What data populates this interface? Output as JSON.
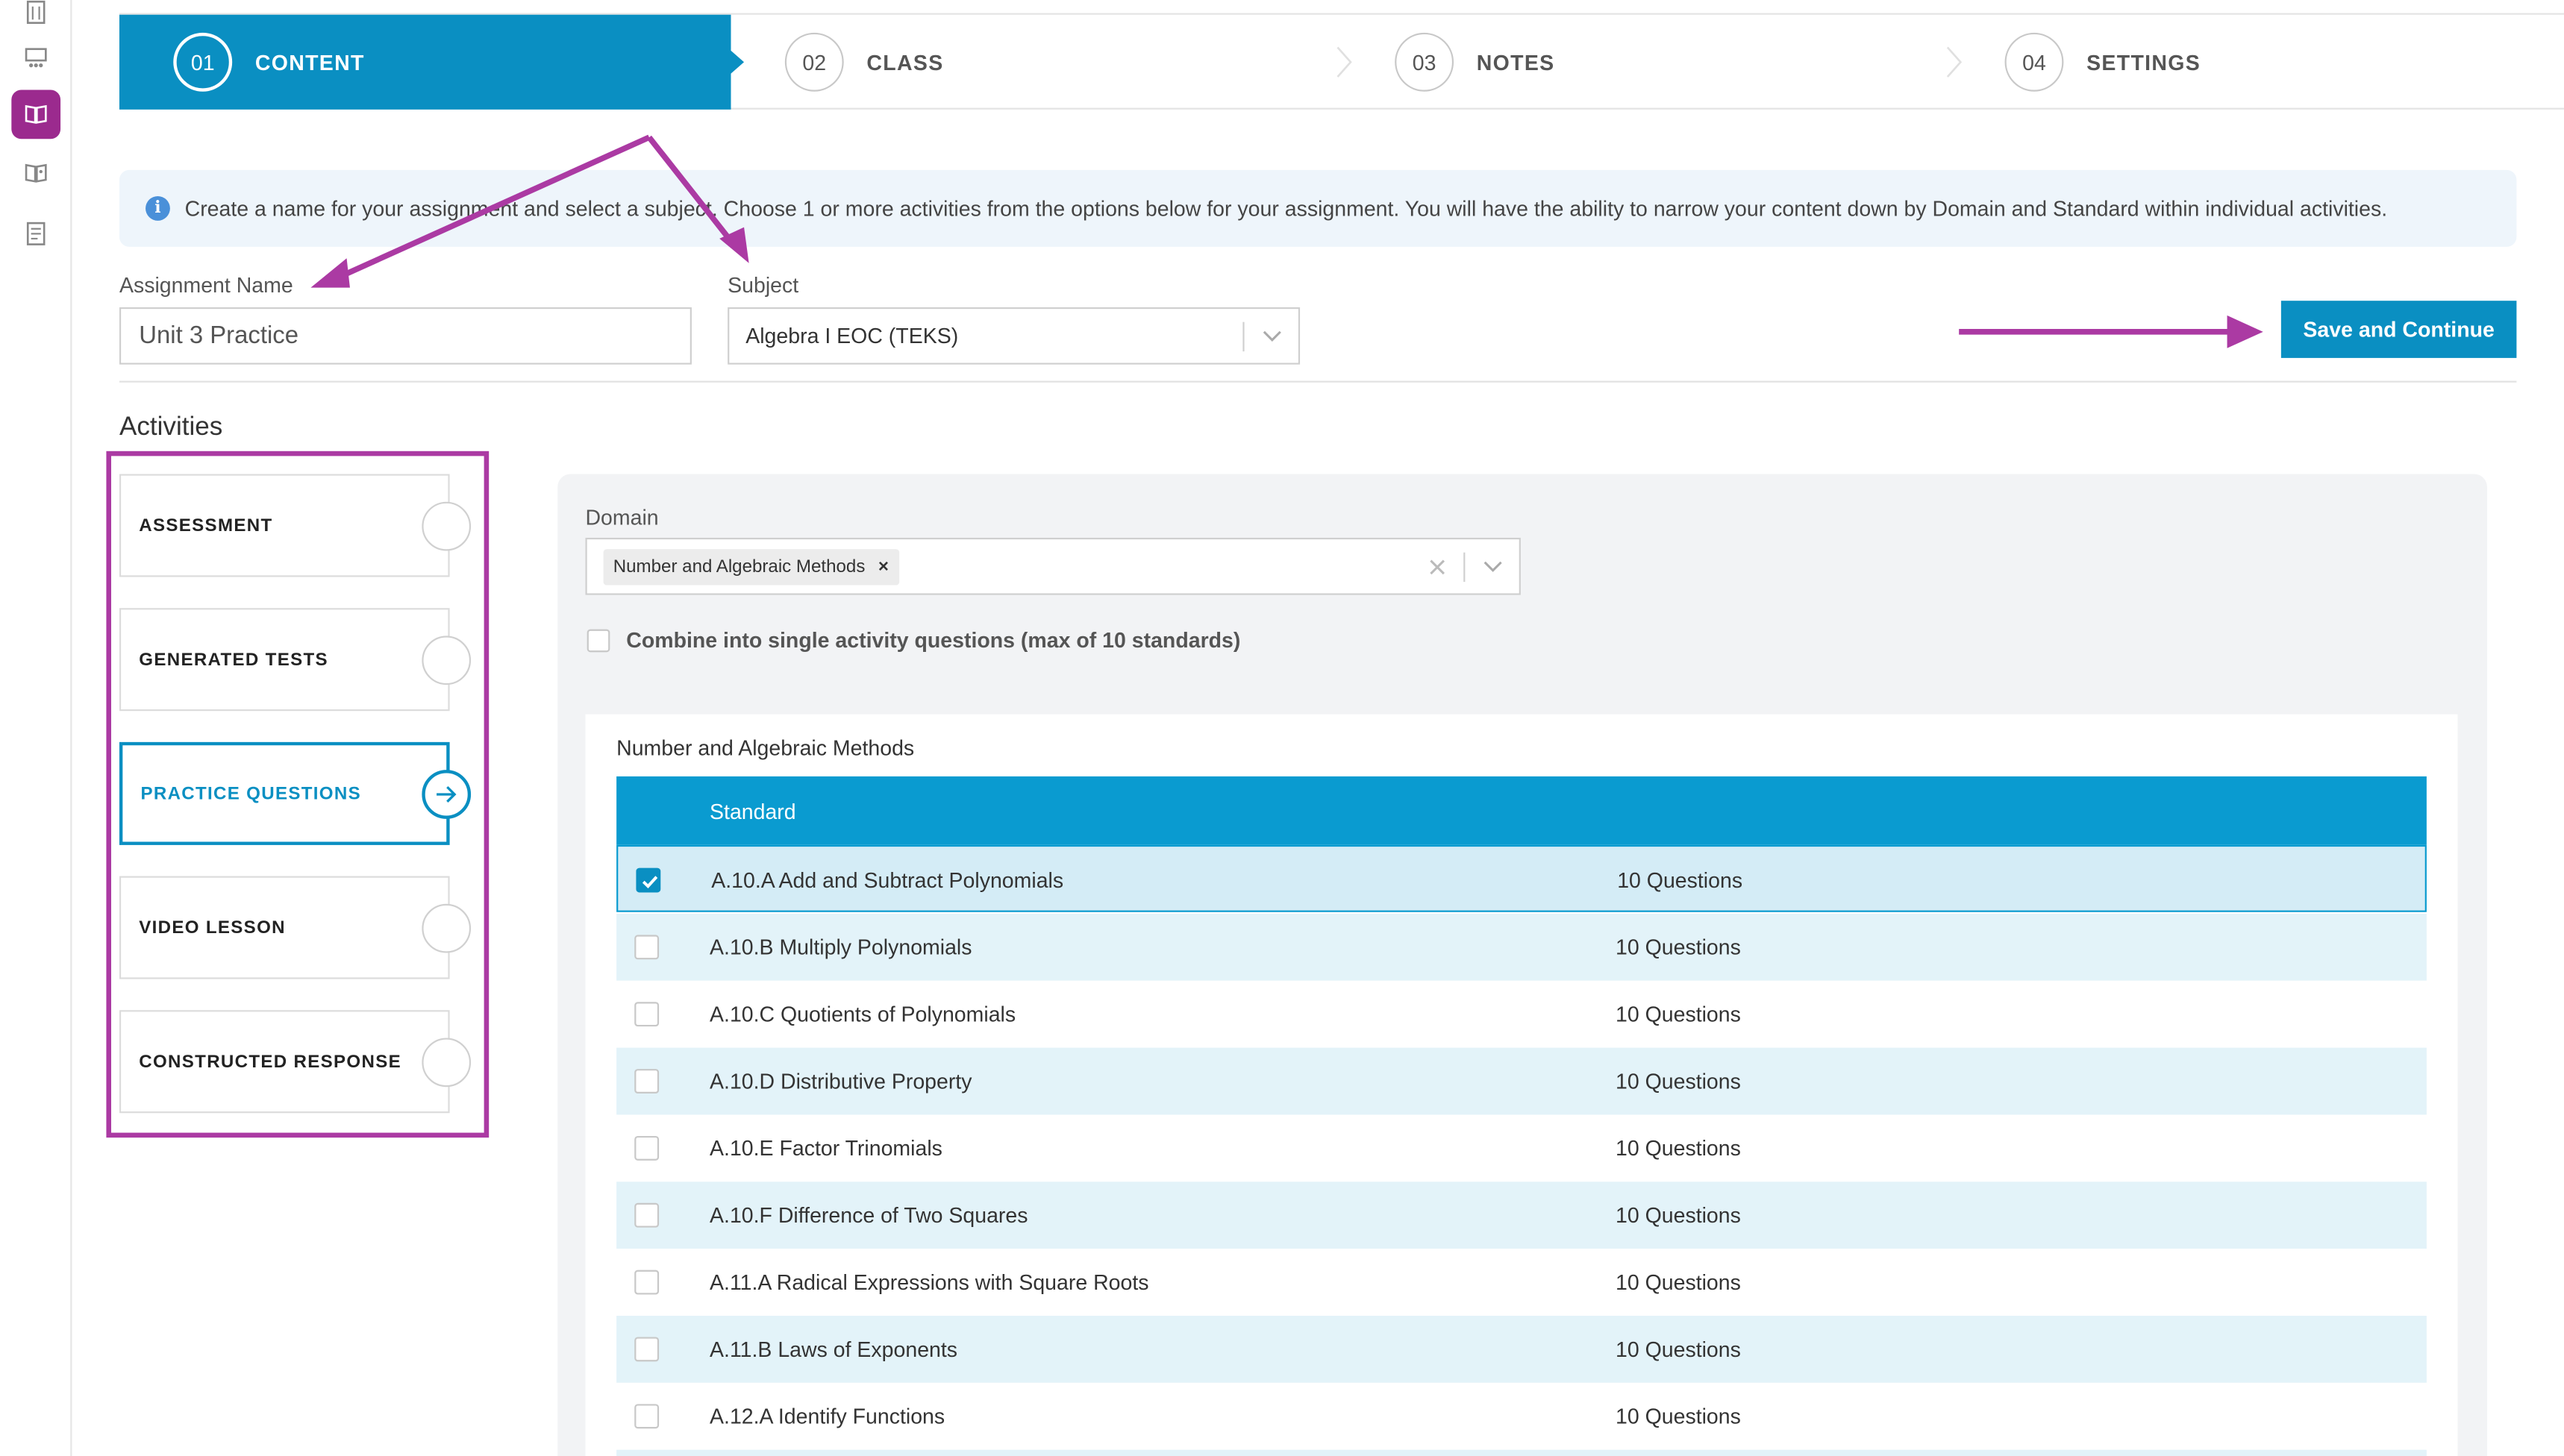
{
  "stepper": {
    "steps": [
      {
        "num": "01",
        "label": "CONTENT"
      },
      {
        "num": "02",
        "label": "CLASS"
      },
      {
        "num": "03",
        "label": "NOTES"
      },
      {
        "num": "04",
        "label": "SETTINGS"
      }
    ],
    "active_step": 0
  },
  "info": {
    "text": "Create a name for your assignment and select a subject. Choose 1 or more activities from the options below for your assignment. You will have the ability to narrow your content down by Domain and Standard within individual activities."
  },
  "form": {
    "assignment_label": "Assignment Name",
    "assignment_value": "Unit 3 Practice",
    "subject_label": "Subject",
    "subject_value": "Algebra I EOC (TEKS)",
    "save_label": "Save and Continue"
  },
  "activities": {
    "title": "Activities",
    "items": [
      {
        "label": "ASSESSMENT"
      },
      {
        "label": "GENERATED TESTS"
      },
      {
        "label": "PRACTICE QUESTIONS"
      },
      {
        "label": "VIDEO LESSON"
      },
      {
        "label": "CONSTRUCTED RESPONSE"
      }
    ],
    "selected_index": 2
  },
  "domain": {
    "label": "Domain",
    "selected_tag": "Number and Algebraic Methods",
    "combine_label": "Combine into single activity questions (max of 10 standards)",
    "combine_checked": false
  },
  "standards": {
    "caption": "Number and Algebraic Methods",
    "header": "Standard",
    "rows": [
      {
        "standard": "A.10.A Add and Subtract Polynomials",
        "questions": "10 Questions",
        "checked": true
      },
      {
        "standard": "A.10.B Multiply Polynomials",
        "questions": "10 Questions",
        "checked": false
      },
      {
        "standard": "A.10.C Quotients of Polynomials",
        "questions": "10 Questions",
        "checked": false
      },
      {
        "standard": "A.10.D Distributive Property",
        "questions": "10 Questions",
        "checked": false
      },
      {
        "standard": "A.10.E Factor Trinomials",
        "questions": "10 Questions",
        "checked": false
      },
      {
        "standard": "A.10.F Difference of Two Squares",
        "questions": "10 Questions",
        "checked": false
      },
      {
        "standard": "A.11.A Radical Expressions with Square Roots",
        "questions": "10 Questions",
        "checked": false
      },
      {
        "standard": "A.11.B Laws of Exponents",
        "questions": "10 Questions",
        "checked": false
      },
      {
        "standard": "A.12.A Identify Functions",
        "questions": "10 Questions",
        "checked": false
      }
    ]
  },
  "colors": {
    "accent": "#0a8fc2",
    "annotation": "#ab3aa3",
    "rail_active": "#9b2a8e"
  }
}
